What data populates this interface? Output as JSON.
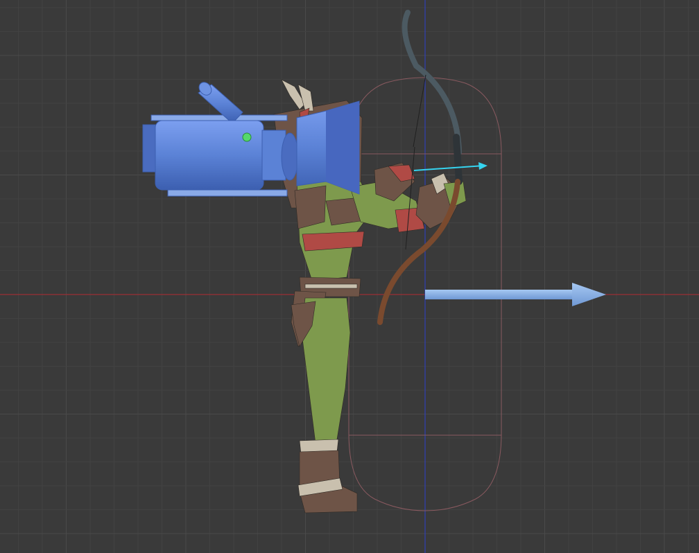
{
  "viewport": {
    "background": "#3a3a3a",
    "grid_minor": "#424242",
    "grid_major": "#4a4a4a",
    "axis_x_color": "#9b2f34",
    "axis_y_color": "#2f3fb5"
  },
  "camera_gizmo": {
    "icon": "camera-icon",
    "color": "#5b82d6",
    "lens_light": "#55d86a"
  },
  "character": {
    "icon": "archer-character-icon",
    "skin": "#7e9a4d",
    "armor": "#6e5447",
    "accent": "#b04a45",
    "bone": "#c9c0ae"
  },
  "bow": {
    "icon": "bow-icon",
    "color": "#7a4a2e",
    "grip": "#4c5a62"
  },
  "forward_arrow": {
    "icon": "forward-direction-arrow-icon",
    "color": "#8fb6e8"
  },
  "aim_arrow": {
    "icon": "aim-ray-arrow-icon",
    "color": "#35d4f0"
  },
  "collider": {
    "icon": "capsule-collider-outline",
    "color": "#8a5a60"
  }
}
